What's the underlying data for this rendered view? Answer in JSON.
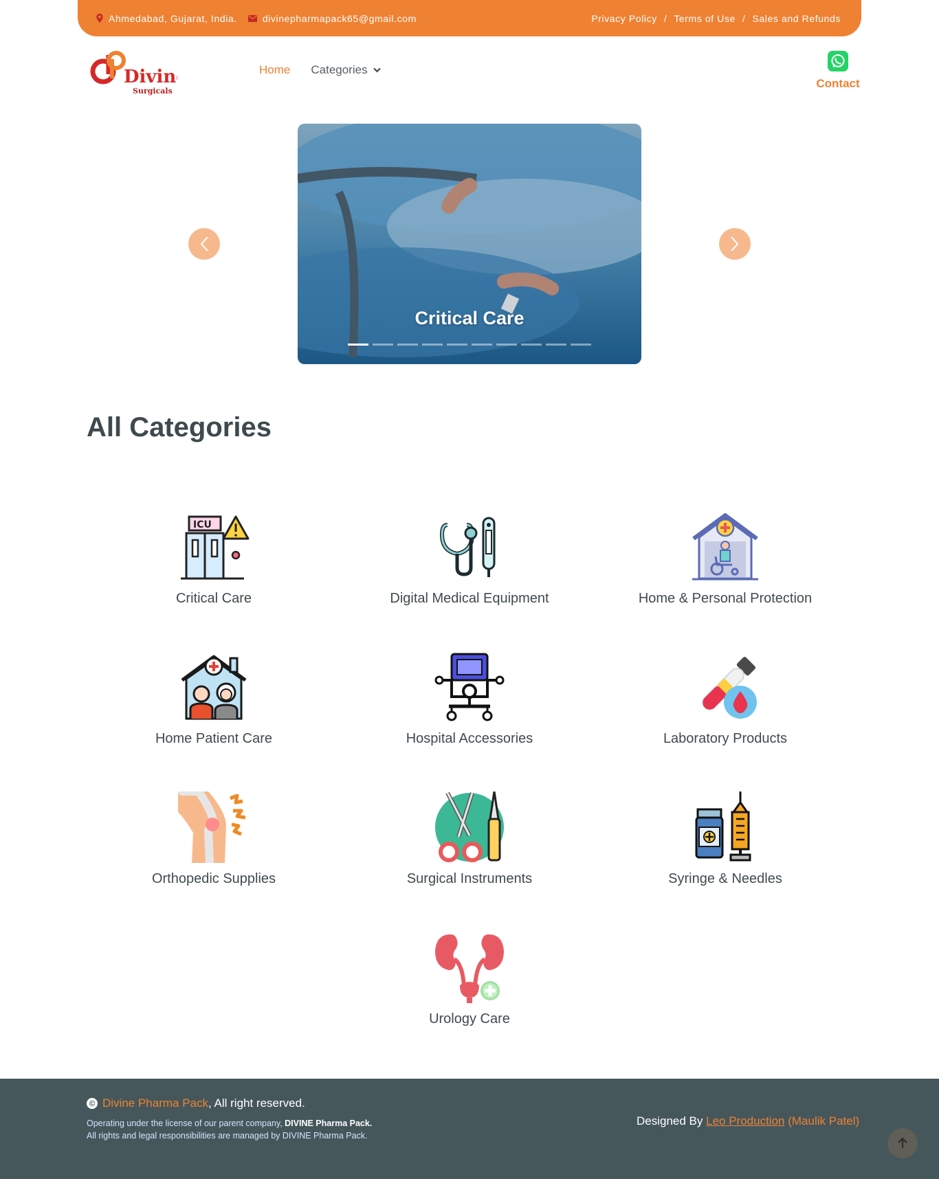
{
  "topbar": {
    "location": "Ahmedabad, Gujarat, India.",
    "email": "divinepharmapack65@gmail.com",
    "links": [
      "Privacy Policy",
      "Terms of Use",
      "Sales and Refunds"
    ],
    "separator": "/"
  },
  "logo": {
    "brand": "Divine",
    "tagline": "Surgicals"
  },
  "nav": {
    "home": "Home",
    "categories": "Categories"
  },
  "contact": {
    "label": "Contact",
    "icon": "whatsapp-icon"
  },
  "slider": {
    "caption": "Critical Care",
    "slide_count": 10,
    "active_index": 0
  },
  "categories": {
    "title": "All Categories",
    "items": [
      {
        "name": "Critical Care",
        "icon": "icu-icon"
      },
      {
        "name": "Digital Medical Equipment",
        "icon": "stethoscope-thermometer-icon"
      },
      {
        "name": "Home & Personal Protection",
        "icon": "home-wheelchair-icon"
      },
      {
        "name": "Home Patient Care",
        "icon": "home-elderly-icon"
      },
      {
        "name": "Hospital Accessories",
        "icon": "hospital-monitor-cart-icon"
      },
      {
        "name": "Laboratory Products",
        "icon": "blood-test-tube-icon"
      },
      {
        "name": "Orthopedic Supplies",
        "icon": "knee-joint-icon"
      },
      {
        "name": "Surgical Instruments",
        "icon": "scissors-scalpel-icon"
      },
      {
        "name": "Syringe & Needles",
        "icon": "syringe-vial-icon"
      },
      {
        "name": "Urology Care",
        "icon": "kidney-icon"
      }
    ]
  },
  "footer": {
    "copyright_brand": "Divine Pharma Pack",
    "copyright_rest": ", All right reserved.",
    "license_prefix": "Operating under the license of our parent company, ",
    "license_company": "DIVINE Pharma Pack.",
    "rights_line": "All rights and legal responsibilities are managed by DIVINE Pharma Pack.",
    "designed_prefix": "Designed By ",
    "designer_link": "Leo Production",
    "designer_author": "(Maulik Patel)"
  },
  "colors": {
    "accent": "#ef8132",
    "footer_bg": "#45575b",
    "text": "#3f4a4e"
  }
}
